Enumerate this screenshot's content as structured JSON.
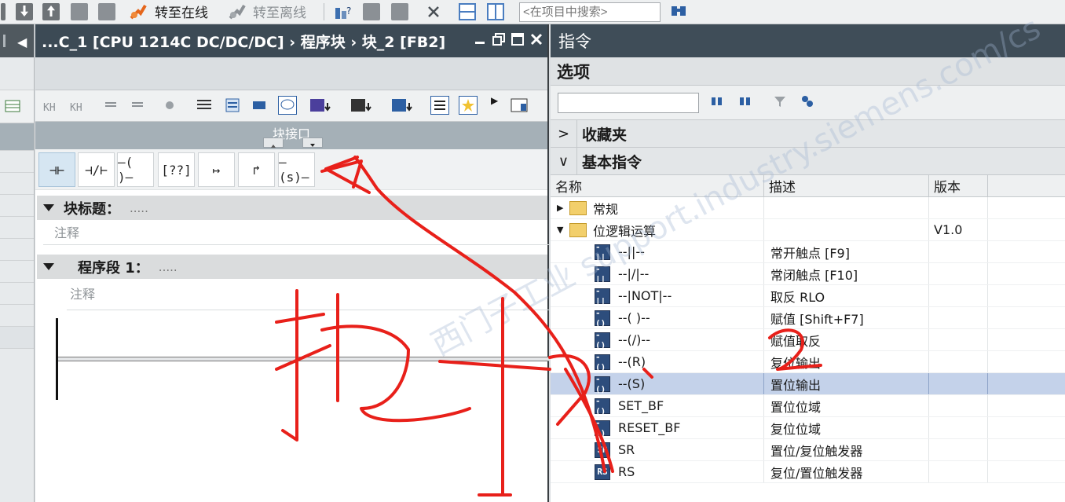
{
  "toolbar": {
    "go_online": "转至在线",
    "go_offline": "转至离线",
    "search_placeholder": "<在项目中搜索>"
  },
  "editor": {
    "title": "...C_1 [CPU 1214C DC/DC/DC] › 程序块 › 块_2 [FB2]",
    "interface_label": "块接口",
    "ladder_items": [
      "⊣⊢",
      "⊣/⊢",
      "–( )–",
      "[??]",
      "↦",
      "↱",
      "–(s)–"
    ],
    "block_title_label": "块标题：",
    "block_title_dots": ".....",
    "block_comment": "注释",
    "network_label": "程序段 1：",
    "network_dots": ".....",
    "network_comment": "注释"
  },
  "instructions": {
    "panel_title": "指令",
    "options_label": "选项",
    "favorites_label": "收藏夹",
    "basic_label": "基本指令",
    "columns": [
      "名称",
      "描述",
      "版本"
    ],
    "rows": [
      {
        "name": "常规",
        "desc": "",
        "ver": "",
        "kind": "folder-collapsed"
      },
      {
        "name": "位逻辑运算",
        "desc": "",
        "ver": "V1.0",
        "kind": "folder-expanded"
      },
      {
        "name": "--||--",
        "desc": "常开触点 [F9]",
        "ver": "",
        "kind": "instr",
        "icon": "-||"
      },
      {
        "name": "--|/|--",
        "desc": "常闭触点 [F10]",
        "ver": "",
        "kind": "instr",
        "icon": "-||"
      },
      {
        "name": "--|NOT|--",
        "desc": "取反 RLO",
        "ver": "",
        "kind": "instr",
        "icon": "-||"
      },
      {
        "name": "--( )--",
        "desc": "赋值 [Shift+F7]",
        "ver": "",
        "kind": "instr",
        "icon": "-()"
      },
      {
        "name": "--(/)--",
        "desc": "赋值取反",
        "ver": "",
        "kind": "instr",
        "icon": "-()"
      },
      {
        "name": "--(R)",
        "desc": "复位输出",
        "ver": "",
        "kind": "instr",
        "icon": "-()"
      },
      {
        "name": "--(S)",
        "desc": "置位输出",
        "ver": "",
        "kind": "instr",
        "icon": "-()",
        "selected": true
      },
      {
        "name": "SET_BF",
        "desc": "置位位域",
        "ver": "",
        "kind": "instr",
        "icon": "-()"
      },
      {
        "name": "RESET_BF",
        "desc": "复位位域",
        "ver": "",
        "kind": "instr",
        "icon": "-()"
      },
      {
        "name": "SR",
        "desc": "置位/复位触发器",
        "ver": "",
        "kind": "instr",
        "icon": "SR"
      },
      {
        "name": "RS",
        "desc": "复位/置位触发器",
        "ver": "",
        "kind": "instr",
        "icon": "RS"
      }
    ]
  },
  "watermark": "西门子工业 support.industry.siemens.com/cs",
  "annotation": {
    "handwritten_text": "拖拽",
    "number": "2",
    "color": "#e8201a"
  }
}
